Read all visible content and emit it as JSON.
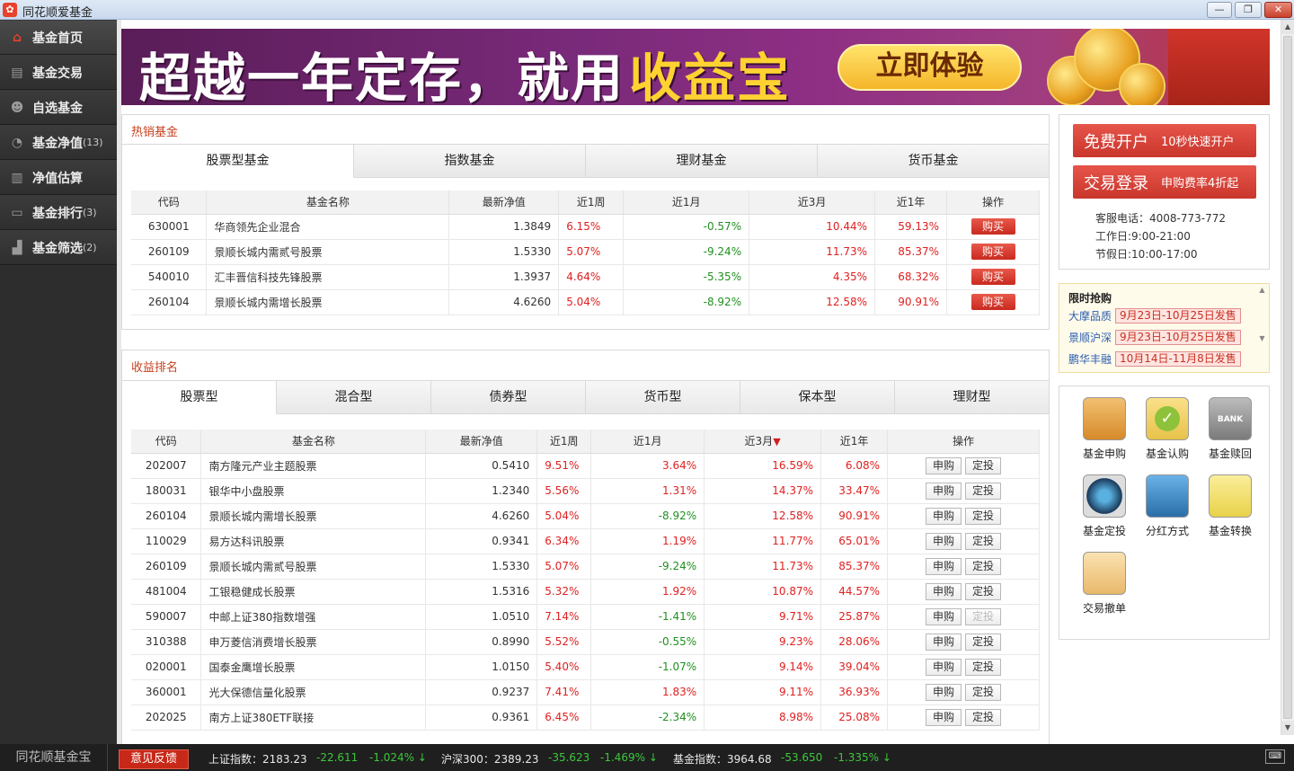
{
  "window": {
    "title": "同花顺爱基金",
    "logo": "✿",
    "minimize": "—",
    "maximize": "❐",
    "close": "✕"
  },
  "sidebar": {
    "items": [
      {
        "label": "基金首页",
        "count": "",
        "icon": "home-icon",
        "glyph": "⌂"
      },
      {
        "label": "基金交易",
        "count": "",
        "icon": "card-icon",
        "glyph": "▤"
      },
      {
        "label": "自选基金",
        "count": "",
        "icon": "user-icon",
        "glyph": "☻"
      },
      {
        "label": "基金净值",
        "count": "(13)",
        "icon": "pie-icon",
        "glyph": "◔"
      },
      {
        "label": "净值估算",
        "count": "",
        "icon": "bars-icon",
        "glyph": "▥"
      },
      {
        "label": "基金排行",
        "count": "(3)",
        "icon": "monitor-icon",
        "glyph": "▭"
      },
      {
        "label": "基金筛选",
        "count": "(2)",
        "icon": "chart-icon",
        "glyph": "▟"
      }
    ]
  },
  "banner": {
    "text1": "超越一年定存，就用",
    "text2": "收益宝",
    "cta": "立即体验"
  },
  "hot": {
    "title": "热销基金",
    "tabs": [
      "股票型基金",
      "指数基金",
      "理财基金",
      "货币基金"
    ],
    "headers": [
      "代码",
      "基金名称",
      "最新净值",
      "近1周",
      "近1月",
      "近3月",
      "近1年",
      "操作"
    ],
    "buy_label": "购买",
    "rows": [
      [
        "630001",
        "华商领先企业混合",
        "1.3849",
        "6.15%",
        "-0.57%",
        "10.44%",
        "59.13%"
      ],
      [
        "260109",
        "景顺长城内需贰号股票",
        "1.5330",
        "5.07%",
        "-9.24%",
        "11.73%",
        "85.37%"
      ],
      [
        "540010",
        "汇丰晋信科技先锋股票",
        "1.3937",
        "4.64%",
        "-5.35%",
        "4.35%",
        "68.32%"
      ],
      [
        "260104",
        "景顺长城内需增长股票",
        "4.6260",
        "5.04%",
        "-8.92%",
        "12.58%",
        "90.91%"
      ]
    ]
  },
  "rank": {
    "title": "收益排名",
    "tabs": [
      "股票型",
      "混合型",
      "债券型",
      "货币型",
      "保本型",
      "理财型"
    ],
    "headers": [
      "代码",
      "基金名称",
      "最新净值",
      "近1周",
      "近1月",
      "近3月",
      "近1年",
      "操作"
    ],
    "sort_arrow": "▼",
    "btn_buy": "申购",
    "btn_plan": "定投",
    "rows": [
      [
        "202007",
        "南方隆元产业主题股票",
        "0.5410",
        "9.51%",
        "3.64%",
        "16.59%",
        "6.08%"
      ],
      [
        "180031",
        "银华中小盘股票",
        "1.2340",
        "5.56%",
        "1.31%",
        "14.37%",
        "33.47%"
      ],
      [
        "260104",
        "景顺长城内需增长股票",
        "4.6260",
        "5.04%",
        "-8.92%",
        "12.58%",
        "90.91%"
      ],
      [
        "110029",
        "易方达科讯股票",
        "0.9341",
        "6.34%",
        "1.19%",
        "11.77%",
        "65.01%"
      ],
      [
        "260109",
        "景顺长城内需贰号股票",
        "1.5330",
        "5.07%",
        "-9.24%",
        "11.73%",
        "85.37%"
      ],
      [
        "481004",
        "工银稳健成长股票",
        "1.5316",
        "5.32%",
        "1.92%",
        "10.87%",
        "44.57%"
      ],
      [
        "590007",
        "中邮上证380指数增强",
        "1.0510",
        "7.14%",
        "-1.41%",
        "9.71%",
        "25.87%"
      ],
      [
        "310388",
        "申万菱信消费增长股票",
        "0.8990",
        "5.52%",
        "-0.55%",
        "9.23%",
        "28.06%"
      ],
      [
        "020001",
        "国泰金鹰增长股票",
        "1.0150",
        "5.40%",
        "-1.07%",
        "9.14%",
        "39.04%"
      ],
      [
        "360001",
        "光大保德信量化股票",
        "0.9237",
        "7.41%",
        "1.83%",
        "9.11%",
        "36.93%"
      ],
      [
        "202025",
        "南方上证380ETF联接",
        "0.9361",
        "6.45%",
        "-2.34%",
        "8.98%",
        "25.08%"
      ]
    ]
  },
  "account": {
    "open_big": "免费开户",
    "open_small": "10秒快速开户",
    "login_big": "交易登录",
    "login_small": "申购费率4折起",
    "phone": "客服电话：4008-773-772",
    "workday": "工作日:9:00-21:00",
    "holiday": "节假日:10:00-17:00"
  },
  "limited": {
    "title": "限时抢购",
    "items": [
      {
        "name": "大摩品质",
        "date": "9月23日-10月25日发售"
      },
      {
        "name": "景顺沪深",
        "date": "9月23日-10月25日发售"
      },
      {
        "name": "鹏华丰融",
        "date": "10月14日-11月8日发售"
      }
    ]
  },
  "tools": [
    {
      "label": "基金申购",
      "icon": "shopping-bag-icon",
      "color": "#e3a046"
    },
    {
      "label": "基金认购",
      "icon": "checkmark-icon",
      "color": "#a8cf3a"
    },
    {
      "label": "基金赎回",
      "icon": "bank-icon",
      "color": "#8a8a8a"
    },
    {
      "label": "基金定投",
      "icon": "clock-icon",
      "color": "#2a6ea0"
    },
    {
      "label": "分红方式",
      "icon": "pulse-chart-icon",
      "color": "#4a9ad0"
    },
    {
      "label": "基金转换",
      "icon": "exchange-icon",
      "color": "#e8d24a"
    },
    {
      "label": "交易撤单",
      "icon": "notepad-icon",
      "color": "#e8c27a"
    }
  ],
  "tool_texts": {
    "bank": "BANK"
  },
  "status": {
    "brand": "同花顺基金宝",
    "feedback": "意见反馈",
    "sh_label": "上证指数：",
    "sh_val": "2183.23",
    "sh_chg": "-22.611",
    "sh_pct": "-1.024%",
    "hs_label": "沪深300：",
    "hs_val": "2389.23",
    "hs_chg": "-35.623",
    "hs_pct": "-1.469%",
    "fund_label": "基金指数：",
    "fund_val": "3964.68",
    "fund_chg": "-53.650",
    "fund_pct": "-1.335%",
    "arrow": "↓",
    "keyboard": "⌨"
  },
  "colors": {
    "up": "#e02020",
    "down": "#209020",
    "accent": "#c8411f"
  }
}
